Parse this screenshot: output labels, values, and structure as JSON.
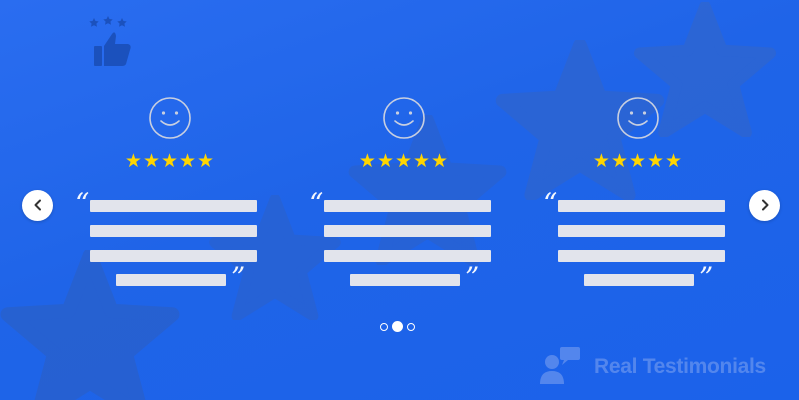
{
  "colors": {
    "background": "#1f64e8",
    "star_rating": "#ffd500",
    "placeholder_line": "#e2e4ec",
    "button": "#ffffff"
  },
  "slider": {
    "prev_icon": "chevron-left-icon",
    "next_icon": "chevron-right-icon",
    "pages": 3,
    "active_page": 2
  },
  "cards": [
    {
      "rating": "★★★★★",
      "rating_value": 5,
      "icon": "smiley-icon"
    },
    {
      "rating": "★★★★★",
      "rating_value": 5,
      "icon": "smiley-icon"
    },
    {
      "rating": "★★★★★",
      "rating_value": 5,
      "icon": "smiley-icon"
    }
  ],
  "quotes": {
    "open": "“",
    "close": "”"
  },
  "brand": {
    "name": "Real Testimonials",
    "icon": "user-chat-icon"
  },
  "decor": {
    "badge_icon": "thumbs-up-stars-icon"
  }
}
